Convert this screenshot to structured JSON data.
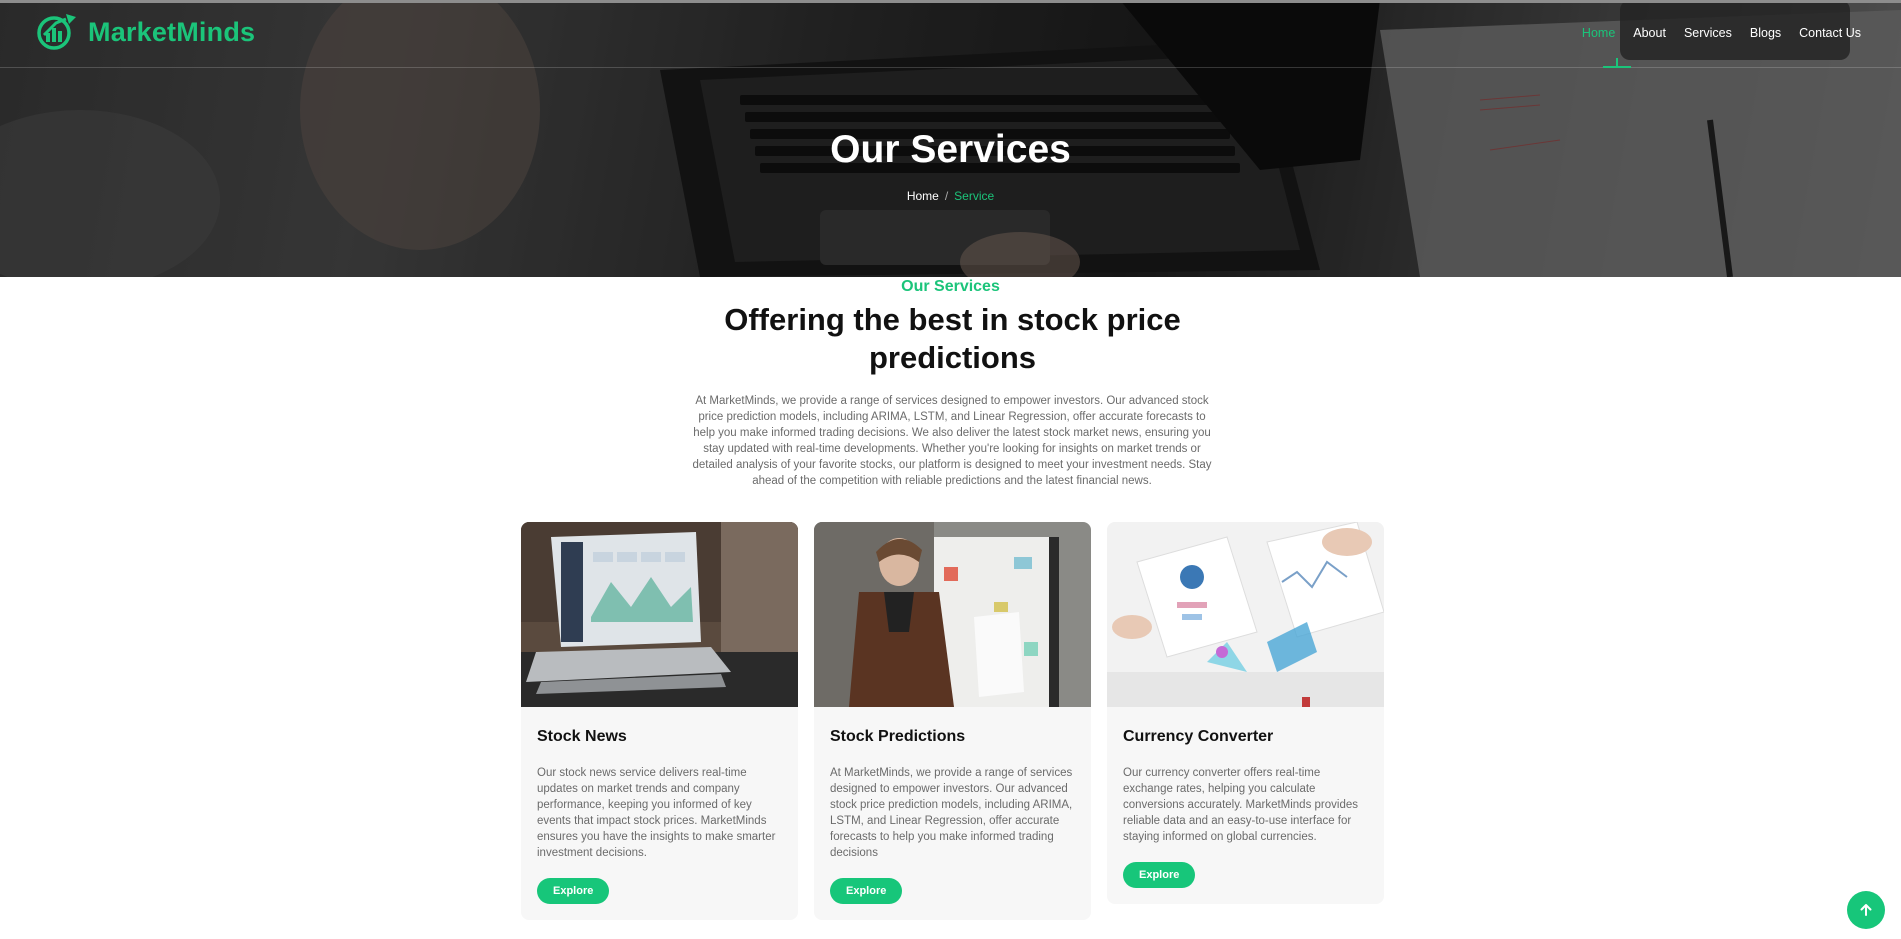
{
  "brand": {
    "name": "MarketMinds",
    "logo_icon": "chart-growth-logo-icon"
  },
  "nav": {
    "items": [
      {
        "label": "Home",
        "active": true
      },
      {
        "label": "About",
        "active": false
      },
      {
        "label": "Services",
        "active": false
      },
      {
        "label": "Blogs",
        "active": false
      },
      {
        "label": "Contact Us",
        "active": false
      }
    ]
  },
  "hero": {
    "title": "Our Services",
    "breadcrumb": {
      "home": "Home",
      "separator": "/",
      "current": "Service"
    }
  },
  "section": {
    "kicker": "Our Services",
    "heading": "Offering the best in stock price predictions",
    "description": "At MarketMinds, we provide a range of services designed to empower investors. Our advanced stock price prediction models, including ARIMA, LSTM, and Linear Regression, offer accurate forecasts to help you make informed trading decisions. We also deliver the latest stock market news, ensuring you stay updated with real-time developments. Whether you're looking for insights on market trends or detailed analysis of your favorite stocks, our platform is designed to meet your investment needs. Stay ahead of the competition with reliable predictions and the latest financial news."
  },
  "cards": [
    {
      "title": "Stock News",
      "text": "Our stock news service delivers real-time updates on market trends and company performance, keeping you informed of key events that impact stock prices. MarketMinds ensures you have the insights to make smarter investment decisions.",
      "button": "Explore"
    },
    {
      "title": "Stock Predictions",
      "text": "At MarketMinds, we provide a range of services designed to empower investors. Our advanced stock price prediction models, including ARIMA, LSTM, and Linear Regression, offer accurate forecasts to help you make informed trading decisions",
      "button": "Explore"
    },
    {
      "title": "Currency Converter",
      "text": "Our currency converter offers real-time exchange rates, helping you calculate conversions accurately. MarketMinds provides reliable data and an easy-to-use interface for staying informed on global currencies.",
      "button": "Explore"
    }
  ],
  "colors": {
    "accent": "#17c67a",
    "text_dark": "#111111",
    "text_muted": "#6b6b6b",
    "card_bg": "#f7f7f7"
  },
  "scroll_top": {
    "icon": "arrow-up-icon"
  }
}
